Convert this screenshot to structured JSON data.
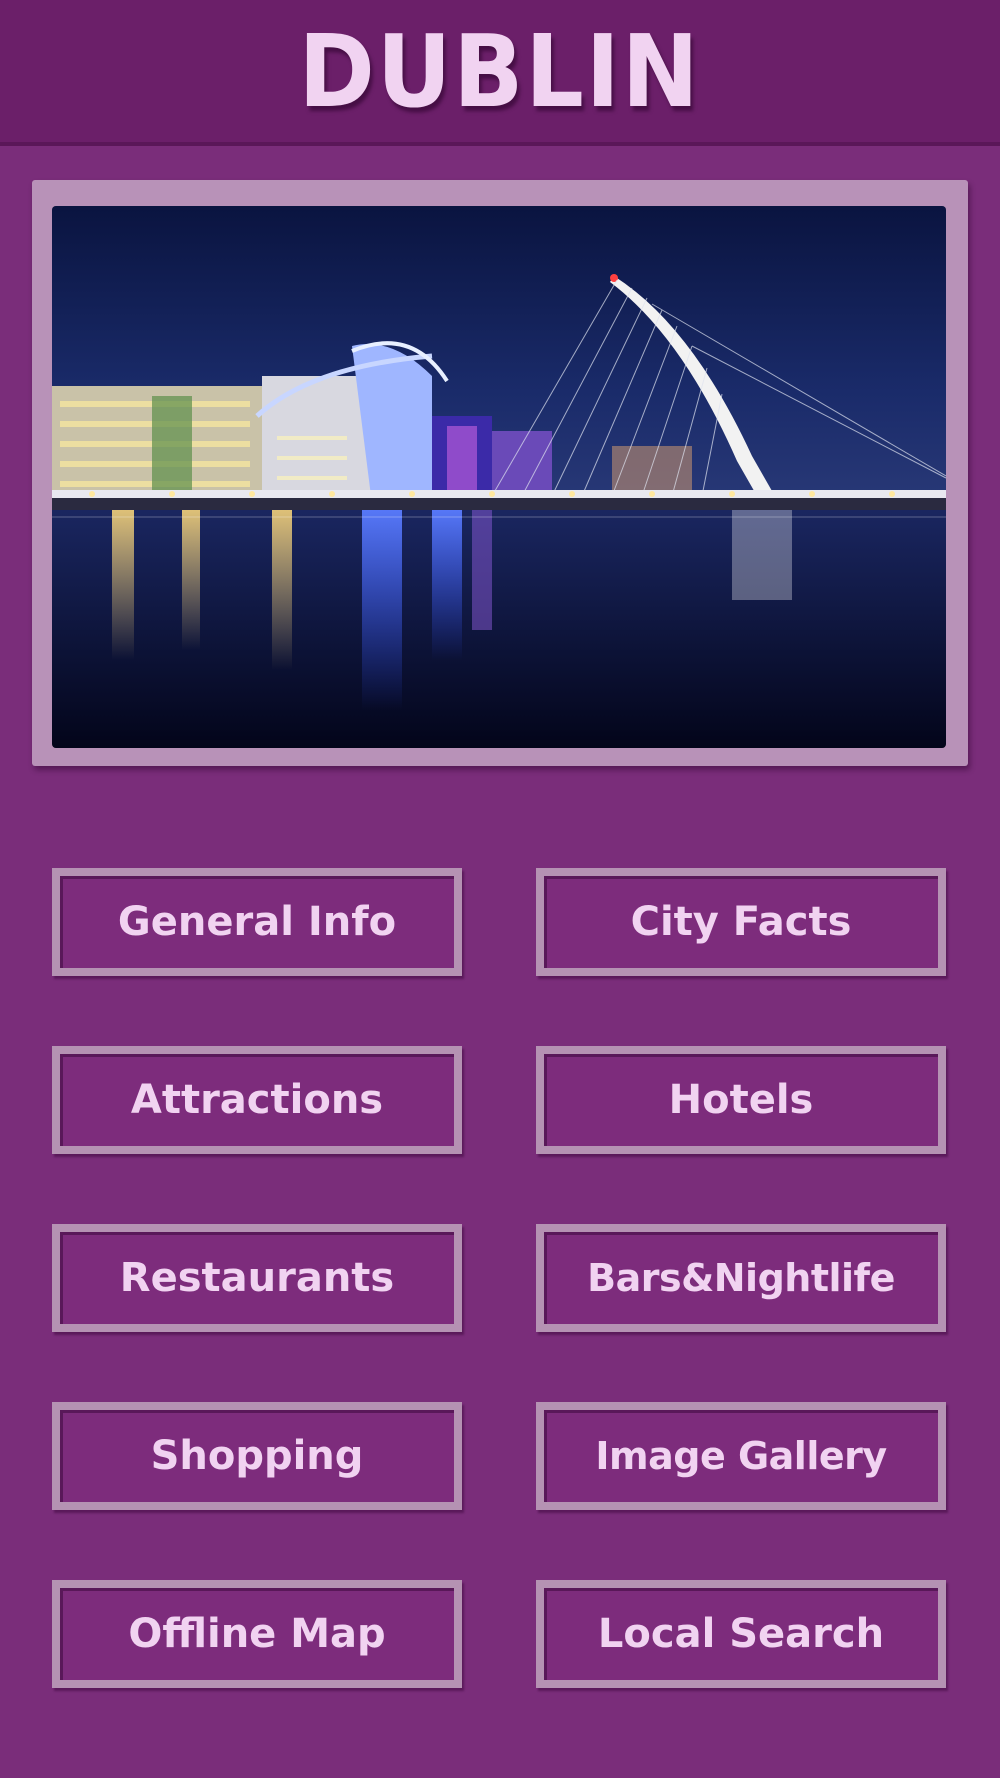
{
  "header": {
    "title": "DUBLIN"
  },
  "hero": {
    "icon": "city-photo"
  },
  "menu": {
    "general_info": "General Info",
    "city_facts": "City Facts",
    "attractions": "Attractions",
    "hotels": "Hotels",
    "restaurants": "Restaurants",
    "bars_nightlife": "Bars&Nightlife",
    "shopping": "Shopping",
    "image_gallery": "Image Gallery",
    "offline_map": "Offline Map",
    "local_search": "Local Search"
  },
  "colors": {
    "background": "#7a2d7a",
    "header": "#6b1f69",
    "button_border": "#b592b3",
    "text": "#f1d3f1"
  }
}
